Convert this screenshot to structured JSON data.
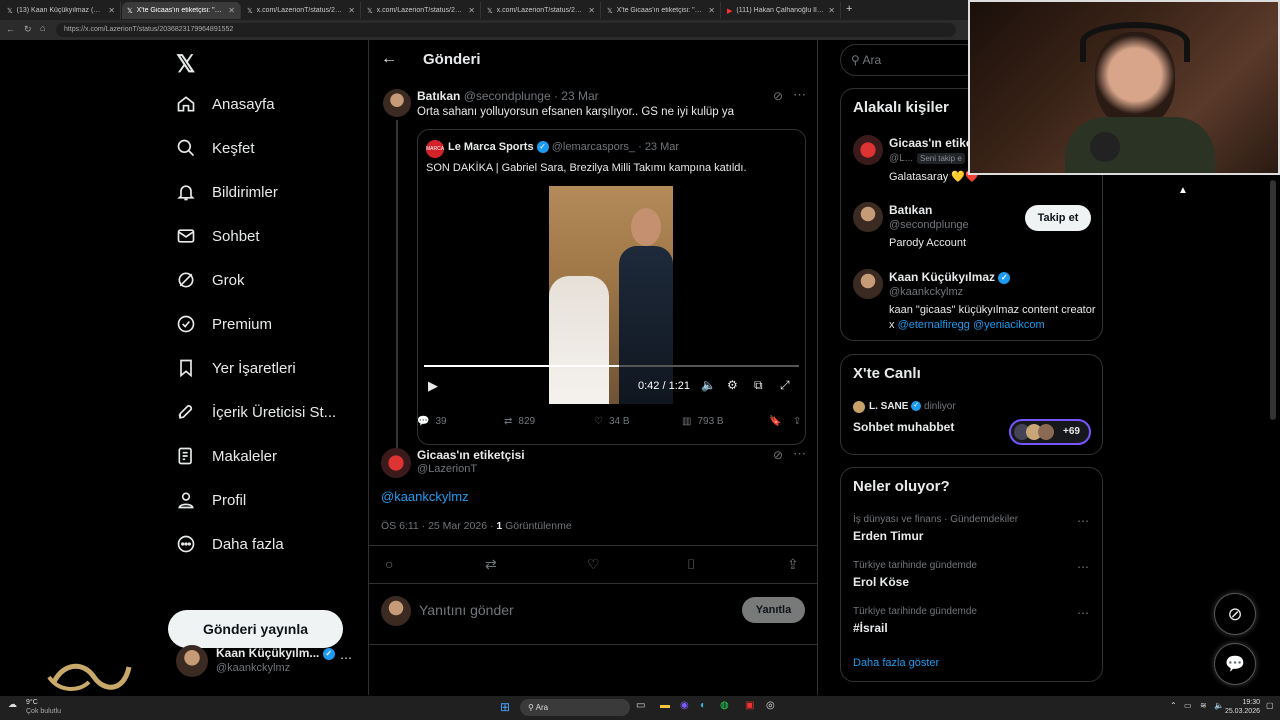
{
  "browser": {
    "tabs": [
      {
        "label": "(13) Kaan Küçükyılmaz (@kaankc",
        "active": false
      },
      {
        "label": "X'te Gicaas'ın etiketçisi: \"@secon",
        "active": true
      },
      {
        "label": "x.com/LazerionT/status/20368231",
        "active": false
      },
      {
        "label": "x.com/LazerionT/status/20368234",
        "active": false
      },
      {
        "label": "x.com/LazerionT/status/20368231",
        "active": false
      },
      {
        "label": "X'te Gicaas'ın etiketçisi: \"@atavrat",
        "active": false
      },
      {
        "label": "(111) Hakan Çalhanoğlu İle Milan'",
        "active": false
      }
    ],
    "url": "https://x.com/LazerionT/status/2036823179964891552"
  },
  "sidebar": {
    "nav": [
      {
        "label": "Anasayfa",
        "icon": "home-icon"
      },
      {
        "label": "Keşfet",
        "icon": "search-icon"
      },
      {
        "label": "Bildirimler",
        "icon": "bell-icon"
      },
      {
        "label": "Sohbet",
        "icon": "mail-icon"
      },
      {
        "label": "Grok",
        "icon": "grok-icon"
      },
      {
        "label": "Premium",
        "icon": "premium-icon"
      },
      {
        "label": "Yer İşaretleri",
        "icon": "bookmark-icon"
      },
      {
        "label": "İçerik Üreticisi St...",
        "icon": "rocket-icon"
      },
      {
        "label": "Makaleler",
        "icon": "article-icon"
      },
      {
        "label": "Profil",
        "icon": "profile-icon"
      },
      {
        "label": "Daha fazla",
        "icon": "more-circle-icon"
      }
    ],
    "post_button": "Gönderi yayınla",
    "account": {
      "name": "Kaan Küçükyılm...",
      "handle": "@kaankckylmz"
    }
  },
  "main": {
    "header": "Gönderi",
    "parent_tweet": {
      "name": "Batıkan",
      "handle": "@secondplunge",
      "date": "· 23 Mar",
      "text": "Orta sahanı yolluyorsun efsanen karşılıyor.. GS ne iyi kulüp ya",
      "quote": {
        "name": "Le Marca Sports",
        "handle": "@lemarcaspors_",
        "date": "· 23 Mar",
        "text": "SON DAKİKA | Gabriel Sara, Brezilya Milli Takımı kampına katıldı.",
        "video_time": "0:42 / 1:21",
        "video_progress": 0.52
      },
      "stats": {
        "replies": "39",
        "reposts": "829",
        "likes": "34 B",
        "views": "793 B"
      }
    },
    "focus_tweet": {
      "name": "Gicaas'ın etiketçisi",
      "handle": "@LazerionT",
      "text": "@kaankckylmz",
      "time": "ÖS 6:11 · 25 Mar 2026 · ",
      "views_count": "1",
      "views_label": "Görüntülenme"
    },
    "reply": {
      "placeholder": "Yanıtını gönder",
      "button": "Yanıtla"
    }
  },
  "right": {
    "search_placeholder": "Ara",
    "related": {
      "title": "Alakalı kişiler",
      "people": [
        {
          "name": "Gicaas'ın etike",
          "handle": "@L...",
          "badge": "Seni takip e",
          "bio": "Galatasaray 💛❤️"
        },
        {
          "name": "Batıkan",
          "handle": "@secondplunge",
          "bio": "Parody Account",
          "follow": "Takip et"
        },
        {
          "name": "Kaan Küçükyılmaz",
          "handle": "@kaankckylmz",
          "bio_prefix": "kaan \"gicaas\" küçükyılmaz content creator x ",
          "bio_link1": "@eternalfiregg",
          "bio_link2": "@yeniacikcom"
        }
      ]
    },
    "live": {
      "title": "X'te Canlı",
      "host": "L. SANE",
      "status": "dinliyor",
      "space": "Sohbet muhabbet",
      "count": "+69"
    },
    "trends": {
      "title": "Neler oluyor?",
      "items": [
        {
          "meta": "İş dünyası ve finans · Gündemdekiler",
          "name": "Erden Timur"
        },
        {
          "meta": "Türkiye tarihinde gündemde",
          "name": "Erol Köse"
        },
        {
          "meta": "Türkiye tarihinde gündemde",
          "name": "#İsrail"
        }
      ],
      "more": "Daha fazla göster"
    }
  },
  "taskbar": {
    "weather_temp": "9°C",
    "weather_text": "Çok bulutlu",
    "search": "Ara",
    "time": "19:30",
    "date": "25.03.2026"
  }
}
